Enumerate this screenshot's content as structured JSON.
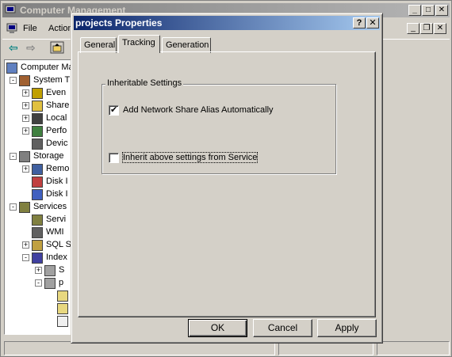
{
  "background_window": {
    "title": "Computer Management",
    "menu": [
      "File",
      "Action"
    ],
    "tree": [
      {
        "label": "Computer Ma",
        "icon": "computer-icon",
        "level": 0,
        "expander": ""
      },
      {
        "label": "System T",
        "icon": "tools-icon",
        "level": 1,
        "expander": "-"
      },
      {
        "label": "Even",
        "icon": "event-viewer-icon",
        "level": 2,
        "expander": "+"
      },
      {
        "label": "Share",
        "icon": "shared-folder-icon",
        "level": 2,
        "expander": "+"
      },
      {
        "label": "Local",
        "icon": "users-icon",
        "level": 2,
        "expander": "+"
      },
      {
        "label": "Perfo",
        "icon": "performance-icon",
        "level": 2,
        "expander": "+"
      },
      {
        "label": "Devic",
        "icon": "device-manager-icon",
        "level": 2,
        "expander": ""
      },
      {
        "label": "Storage",
        "icon": "storage-icon",
        "level": 1,
        "expander": "-"
      },
      {
        "label": "Remo",
        "icon": "removable-storage-icon",
        "level": 2,
        "expander": "+"
      },
      {
        "label": "Disk I",
        "icon": "disk-defrag-icon",
        "level": 2,
        "expander": ""
      },
      {
        "label": "Disk I",
        "icon": "disk-management-icon",
        "level": 2,
        "expander": ""
      },
      {
        "label": "Services",
        "icon": "services-icon",
        "level": 1,
        "expander": "-"
      },
      {
        "label": "Servi",
        "icon": "services-icon",
        "level": 2,
        "expander": ""
      },
      {
        "label": "WMI",
        "icon": "wmi-icon",
        "level": 2,
        "expander": ""
      },
      {
        "label": "SQL S",
        "icon": "sql-icon",
        "level": 2,
        "expander": "+"
      },
      {
        "label": "Index",
        "icon": "indexing-icon",
        "level": 2,
        "expander": "-"
      },
      {
        "label": "S",
        "icon": "catalog-icon",
        "level": 3,
        "expander": "+"
      },
      {
        "label": "p",
        "icon": "catalog-icon",
        "level": 3,
        "expander": "-"
      },
      {
        "label": "",
        "icon": "folder-icon",
        "level": 4,
        "expander": ""
      },
      {
        "label": "",
        "icon": "folder-icon",
        "level": 4,
        "expander": ""
      },
      {
        "label": "",
        "icon": "document-icon",
        "level": 4,
        "expander": ""
      }
    ]
  },
  "dialog": {
    "title": "projects Properties",
    "help_label": "?",
    "close_label": "✕",
    "tabs": [
      {
        "label": "General",
        "active": false
      },
      {
        "label": "Tracking",
        "active": true
      },
      {
        "label": "Generation",
        "active": false
      }
    ],
    "group": {
      "legend": "Inheritable Settings",
      "checkbox_alias": {
        "label": "Add Network Share Alias Automatically",
        "checked": true
      },
      "checkbox_inherit": {
        "label": "Inherit above settings from Service",
        "checked": false
      }
    },
    "buttons": {
      "ok": "OK",
      "cancel": "Cancel",
      "apply": "Apply"
    }
  },
  "colors": {
    "dialog_title_start": "#0a246a",
    "dialog_title_end": "#a6caf0",
    "inactive_title_start": "#808080",
    "face": "#d4d0c8"
  }
}
